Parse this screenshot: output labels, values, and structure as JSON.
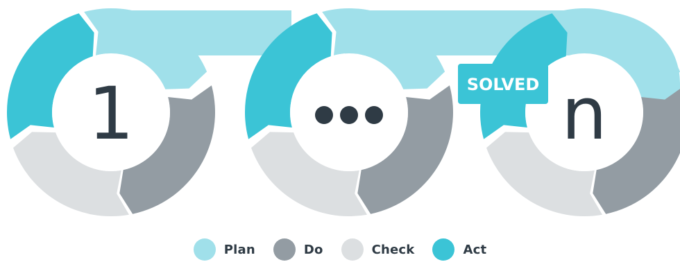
{
  "colors": {
    "plan": "#a0e0ea",
    "do": "#939ca3",
    "check": "#dcdfe1",
    "act": "#3bc4d6",
    "text": "#2f3b45",
    "badge_text": "#ffffff"
  },
  "cycles": [
    {
      "label": "1",
      "type": "text"
    },
    {
      "label": "•••",
      "type": "dots"
    },
    {
      "label": "n",
      "type": "text"
    }
  ],
  "badge": {
    "label": "SOLVED"
  },
  "legend": [
    {
      "label": "Plan",
      "key": "plan"
    },
    {
      "label": "Do",
      "key": "do"
    },
    {
      "label": "Check",
      "key": "check"
    },
    {
      "label": "Act",
      "key": "act"
    }
  ]
}
